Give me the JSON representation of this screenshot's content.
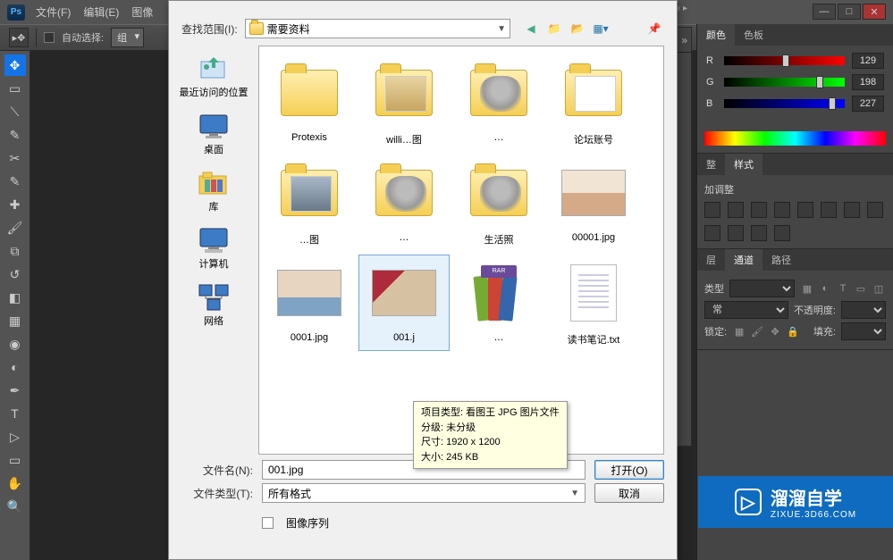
{
  "app": {
    "logo": "Ps"
  },
  "menu": {
    "file": "文件(F)",
    "edit": "编辑(E)",
    "image_partial": "图像"
  },
  "window_buttons": {
    "min": "—",
    "max": "□",
    "close": "✕"
  },
  "options_bar": {
    "auto_select_label": "自动选择:",
    "group": "组"
  },
  "tools": [
    "move",
    "rect-marquee",
    "lasso",
    "quick-select",
    "crop",
    "eyedropper",
    "healing",
    "brush",
    "clone",
    "history-brush",
    "eraser",
    "gradient",
    "blur",
    "dodge",
    "pen",
    "type",
    "path-select",
    "rectangle",
    "hand",
    "zoom",
    "swap",
    "fg-bg"
  ],
  "right_panels": {
    "color_tab": "颜色",
    "swatch_tab": "色板",
    "r_label": "R",
    "g_label": "G",
    "b_label": "B",
    "r_val": "129",
    "g_val": "198",
    "b_val": "227",
    "layers_tab1": "图层",
    "channels_tab": "通道",
    "paths_tab": "路径",
    "styles_tab": "样式",
    "adjust_label": "加调整",
    "kind_label": "类型",
    "blend_normal": "常",
    "opacity_label": "不透明度:",
    "fill_label": "填充:",
    "lock_label": "锁定:"
  },
  "dialog": {
    "lookin_label": "查找范围(I):",
    "lookin_value": "需要资料",
    "filename_label": "文件名(N):",
    "filename_value": "001.jpg",
    "filetype_label": "文件类型(T):",
    "filetype_value": "所有格式",
    "open_btn": "打开(O)",
    "cancel_btn": "取消",
    "image_seq": "图像序列"
  },
  "places": {
    "recent": "最近访问的位置",
    "desktop": "桌面",
    "libraries": "库",
    "computer": "计算机",
    "network": "网络"
  },
  "files": {
    "r1c1": "Protexis",
    "r1c2": "willi…图",
    "r1c3": "…",
    "r1c4": "论坛账号",
    "r2c1": "…图",
    "r2c2": "…",
    "r2c3": "生活照",
    "r2c4": "00001.jpg",
    "r3c1": "0001.jpg",
    "r3c2": "001.j",
    "r3c3": "…",
    "r3c4": "读书笔记.txt"
  },
  "tooltip": {
    "l1": "项目类型: 看图王 JPG 图片文件",
    "l2": "分级: 未分级",
    "l3": "尺寸: 1920 x 1200",
    "l4": "大小: 245 KB"
  },
  "watermark": {
    "brand": "溜溜自学",
    "sub": "ZIXUE.3D66.COM"
  }
}
